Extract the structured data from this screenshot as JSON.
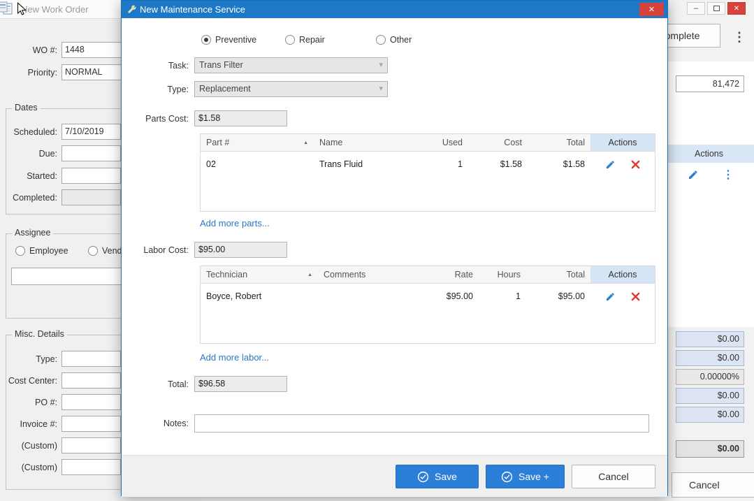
{
  "icons": {
    "close": "✕",
    "minimize": "–",
    "kebab": "⋮",
    "sort_asc": "▲",
    "dropdown": "▾"
  },
  "left_window": {
    "title": "New Work Order",
    "wo": {
      "label": "WO #:",
      "value": "1448"
    },
    "priority": {
      "label": "Priority:",
      "value": "NORMAL"
    },
    "dates": {
      "title": "Dates",
      "scheduled": {
        "label": "Scheduled:",
        "value": "7/10/2019"
      },
      "due": {
        "label": "Due:",
        "value": ""
      },
      "started": {
        "label": "Started:",
        "value": ""
      },
      "completed": {
        "label": "Completed:",
        "value": ""
      }
    },
    "assignee": {
      "title": "Assignee",
      "employee_label": "Employee",
      "vendor_label": "Vendor",
      "selected": "",
      "input_value": ""
    },
    "misc": {
      "title": "Misc. Details",
      "rows": [
        {
          "label": "Type:",
          "value": ""
        },
        {
          "label": "Cost Center:",
          "value": ""
        },
        {
          "label": "PO #:",
          "value": ""
        },
        {
          "label": "Invoice #:",
          "value": ""
        },
        {
          "label": "(Custom)",
          "value": ""
        },
        {
          "label": "(Custom)",
          "value": ""
        }
      ]
    }
  },
  "right_panel": {
    "complete_button": "Complete",
    "meter_value": "81,472",
    "actions_header": "Actions",
    "amounts": [
      "$0.00",
      "$0.00",
      "0.00000%",
      "$0.00",
      "$0.00"
    ],
    "total": "$0.00",
    "cancel_button": "Cancel"
  },
  "dialog": {
    "title": "New Maintenance Service",
    "service_types": [
      {
        "label": "Preventive",
        "selected": true
      },
      {
        "label": "Repair",
        "selected": false
      },
      {
        "label": "Other",
        "selected": false
      }
    ],
    "task": {
      "label": "Task:",
      "value": "Trans Filter"
    },
    "type": {
      "label": "Type:",
      "value": "Replacement"
    },
    "parts_cost": {
      "label": "Parts Cost:",
      "value": "$1.58"
    },
    "parts_table": {
      "headers": [
        "Part #",
        "Name",
        "Used",
        "Cost",
        "Total",
        "Actions"
      ],
      "row": {
        "part": "02",
        "name": "Trans Fluid",
        "used": "1",
        "cost": "$1.58",
        "total": "$1.58"
      }
    },
    "add_parts_link": "Add more parts...",
    "labor_cost": {
      "label": "Labor Cost:",
      "value": "$95.00"
    },
    "labor_table": {
      "headers": [
        "Technician",
        "Comments",
        "Rate",
        "Hours",
        "Total",
        "Actions"
      ],
      "row": {
        "technician": "Boyce, Robert",
        "comments": "",
        "rate": "$95.00",
        "hours": "1",
        "total": "$95.00"
      }
    },
    "add_labor_link": "Add more labor...",
    "total": {
      "label": "Total:",
      "value": "$96.58"
    },
    "notes": {
      "label": "Notes:",
      "value": ""
    },
    "buttons": {
      "save": "Save",
      "save_plus": "Save +",
      "cancel": "Cancel"
    }
  }
}
